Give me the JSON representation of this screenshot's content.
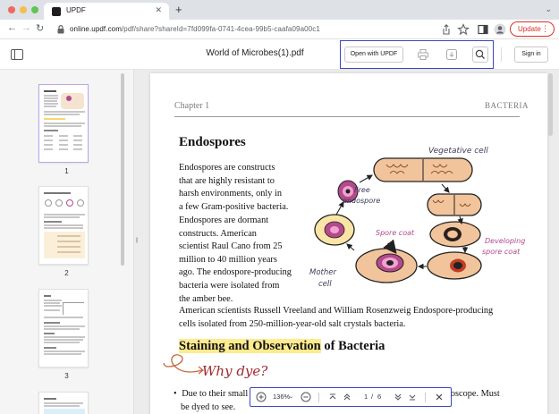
{
  "browser": {
    "tab_title": "UPDF",
    "tab_close": "✕",
    "new_tab": "+",
    "url_host": "online.updf.com",
    "url_path": "/pdf/share?shareId=7fd099fa-0741-4cea-99b5-caafa09a00c1",
    "update_label": "Update",
    "more": "⋮",
    "traffic_colors": [
      "#ed6a5e",
      "#f5bf4f",
      "#61c554"
    ]
  },
  "app": {
    "doc_title": "World of Microbes(1).pdf",
    "open_with_label": "Open with UPDF",
    "sign_in_label": "Sign in",
    "accent": "#3b45c7"
  },
  "thumbnails": [
    {
      "page": "1"
    },
    {
      "page": "2"
    },
    {
      "page": "3"
    }
  ],
  "page": {
    "chapter": "Chapter 1",
    "section": "BACTERIA",
    "heading": "Endospores",
    "para1_lines": [
      "Endospores are constructs",
      "that are highly resistant to",
      "harsh environments, only in",
      "a few Gram-positive bacteria."
    ],
    "para2_lines": [
      "Endospores are dormant",
      "constructs. American",
      "scientist Raul Cano from 25",
      "million to 40 million years",
      "ago. The endospore-producing",
      "bacteria were isolated from",
      "the amber bee."
    ],
    "para3_lines": [
      "American scientists Russell Vreeland and William Rosenzweig Endospore-producing",
      "cells isolated from 250-million-year-old salt crystals bacteria."
    ],
    "stain_highlight": "Staining and Observation",
    "stain_rest": " of Bacteria",
    "why_dye": "Why dye?",
    "bullet_line1": "Due to their small",
    "bullet_line1_end": "icroscope. Must",
    "bullet_line2": "be dyed to see.",
    "bullet_mark": "•",
    "illustration_labels": {
      "vegetative": "Vegetative cell",
      "free": "Free",
      "endospore": "endospore",
      "spore_coat": "Spore coat",
      "developing": "Developing",
      "dev_spore_coat": "spore coat",
      "mother": "Mother",
      "cell": "cell"
    }
  },
  "toolbar": {
    "zoom": "136%",
    "page_current": "1",
    "page_sep": "/",
    "page_total": "6"
  }
}
